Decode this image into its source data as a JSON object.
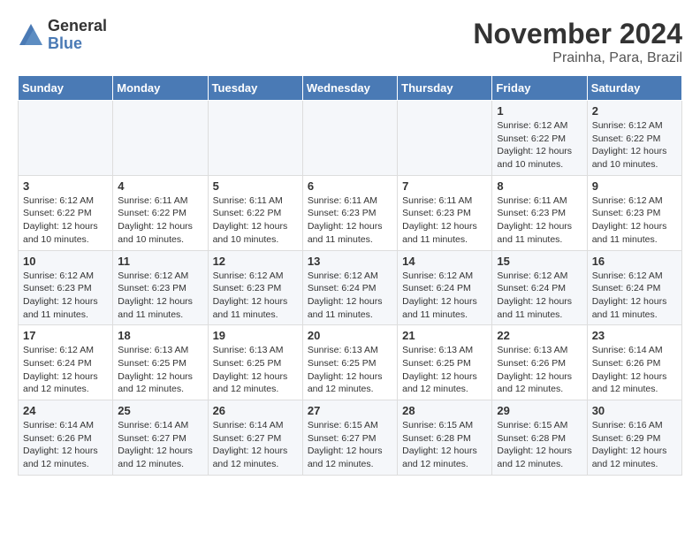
{
  "logo": {
    "general": "General",
    "blue": "Blue"
  },
  "title": "November 2024",
  "location": "Prainha, Para, Brazil",
  "days_of_week": [
    "Sunday",
    "Monday",
    "Tuesday",
    "Wednesday",
    "Thursday",
    "Friday",
    "Saturday"
  ],
  "weeks": [
    [
      {
        "day": "",
        "info": ""
      },
      {
        "day": "",
        "info": ""
      },
      {
        "day": "",
        "info": ""
      },
      {
        "day": "",
        "info": ""
      },
      {
        "day": "",
        "info": ""
      },
      {
        "day": "1",
        "info": "Sunrise: 6:12 AM\nSunset: 6:22 PM\nDaylight: 12 hours\nand 10 minutes."
      },
      {
        "day": "2",
        "info": "Sunrise: 6:12 AM\nSunset: 6:22 PM\nDaylight: 12 hours\nand 10 minutes."
      }
    ],
    [
      {
        "day": "3",
        "info": "Sunrise: 6:12 AM\nSunset: 6:22 PM\nDaylight: 12 hours\nand 10 minutes."
      },
      {
        "day": "4",
        "info": "Sunrise: 6:11 AM\nSunset: 6:22 PM\nDaylight: 12 hours\nand 10 minutes."
      },
      {
        "day": "5",
        "info": "Sunrise: 6:11 AM\nSunset: 6:22 PM\nDaylight: 12 hours\nand 10 minutes."
      },
      {
        "day": "6",
        "info": "Sunrise: 6:11 AM\nSunset: 6:23 PM\nDaylight: 12 hours\nand 11 minutes."
      },
      {
        "day": "7",
        "info": "Sunrise: 6:11 AM\nSunset: 6:23 PM\nDaylight: 12 hours\nand 11 minutes."
      },
      {
        "day": "8",
        "info": "Sunrise: 6:11 AM\nSunset: 6:23 PM\nDaylight: 12 hours\nand 11 minutes."
      },
      {
        "day": "9",
        "info": "Sunrise: 6:12 AM\nSunset: 6:23 PM\nDaylight: 12 hours\nand 11 minutes."
      }
    ],
    [
      {
        "day": "10",
        "info": "Sunrise: 6:12 AM\nSunset: 6:23 PM\nDaylight: 12 hours\nand 11 minutes."
      },
      {
        "day": "11",
        "info": "Sunrise: 6:12 AM\nSunset: 6:23 PM\nDaylight: 12 hours\nand 11 minutes."
      },
      {
        "day": "12",
        "info": "Sunrise: 6:12 AM\nSunset: 6:23 PM\nDaylight: 12 hours\nand 11 minutes."
      },
      {
        "day": "13",
        "info": "Sunrise: 6:12 AM\nSunset: 6:24 PM\nDaylight: 12 hours\nand 11 minutes."
      },
      {
        "day": "14",
        "info": "Sunrise: 6:12 AM\nSunset: 6:24 PM\nDaylight: 12 hours\nand 11 minutes."
      },
      {
        "day": "15",
        "info": "Sunrise: 6:12 AM\nSunset: 6:24 PM\nDaylight: 12 hours\nand 11 minutes."
      },
      {
        "day": "16",
        "info": "Sunrise: 6:12 AM\nSunset: 6:24 PM\nDaylight: 12 hours\nand 11 minutes."
      }
    ],
    [
      {
        "day": "17",
        "info": "Sunrise: 6:12 AM\nSunset: 6:24 PM\nDaylight: 12 hours\nand 12 minutes."
      },
      {
        "day": "18",
        "info": "Sunrise: 6:13 AM\nSunset: 6:25 PM\nDaylight: 12 hours\nand 12 minutes."
      },
      {
        "day": "19",
        "info": "Sunrise: 6:13 AM\nSunset: 6:25 PM\nDaylight: 12 hours\nand 12 minutes."
      },
      {
        "day": "20",
        "info": "Sunrise: 6:13 AM\nSunset: 6:25 PM\nDaylight: 12 hours\nand 12 minutes."
      },
      {
        "day": "21",
        "info": "Sunrise: 6:13 AM\nSunset: 6:25 PM\nDaylight: 12 hours\nand 12 minutes."
      },
      {
        "day": "22",
        "info": "Sunrise: 6:13 AM\nSunset: 6:26 PM\nDaylight: 12 hours\nand 12 minutes."
      },
      {
        "day": "23",
        "info": "Sunrise: 6:14 AM\nSunset: 6:26 PM\nDaylight: 12 hours\nand 12 minutes."
      }
    ],
    [
      {
        "day": "24",
        "info": "Sunrise: 6:14 AM\nSunset: 6:26 PM\nDaylight: 12 hours\nand 12 minutes."
      },
      {
        "day": "25",
        "info": "Sunrise: 6:14 AM\nSunset: 6:27 PM\nDaylight: 12 hours\nand 12 minutes."
      },
      {
        "day": "26",
        "info": "Sunrise: 6:14 AM\nSunset: 6:27 PM\nDaylight: 12 hours\nand 12 minutes."
      },
      {
        "day": "27",
        "info": "Sunrise: 6:15 AM\nSunset: 6:27 PM\nDaylight: 12 hours\nand 12 minutes."
      },
      {
        "day": "28",
        "info": "Sunrise: 6:15 AM\nSunset: 6:28 PM\nDaylight: 12 hours\nand 12 minutes."
      },
      {
        "day": "29",
        "info": "Sunrise: 6:15 AM\nSunset: 6:28 PM\nDaylight: 12 hours\nand 12 minutes."
      },
      {
        "day": "30",
        "info": "Sunrise: 6:16 AM\nSunset: 6:29 PM\nDaylight: 12 hours\nand 12 minutes."
      }
    ]
  ]
}
